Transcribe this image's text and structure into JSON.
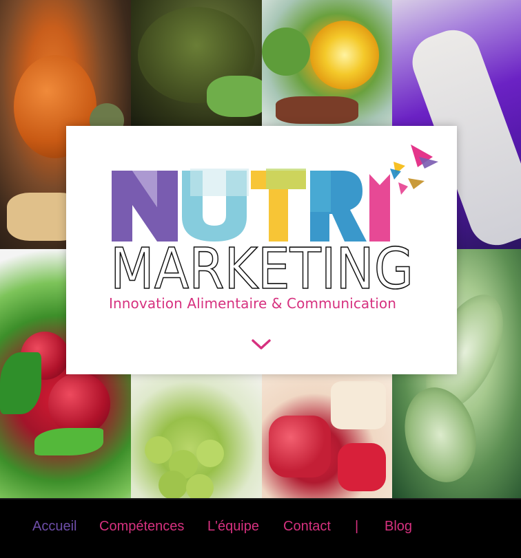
{
  "brand": {
    "title_top": "NUTRI",
    "title_bottom": "MARKETING",
    "tagline": "Innovation Alimentaire & Communication"
  },
  "icons": {
    "scroll_down": "chevron-down-icon"
  },
  "nav": {
    "items": [
      {
        "label": "Accueil",
        "active": true
      },
      {
        "label": "Compétences",
        "active": false
      },
      {
        "label": "L'équipe",
        "active": false
      },
      {
        "label": "Contact",
        "active": false
      }
    ],
    "separator": "|",
    "blog_label": "Blog"
  },
  "colors": {
    "accent_pink": "#d6317f",
    "active_purple": "#6e4ea9",
    "nav_bg": "#000000"
  }
}
